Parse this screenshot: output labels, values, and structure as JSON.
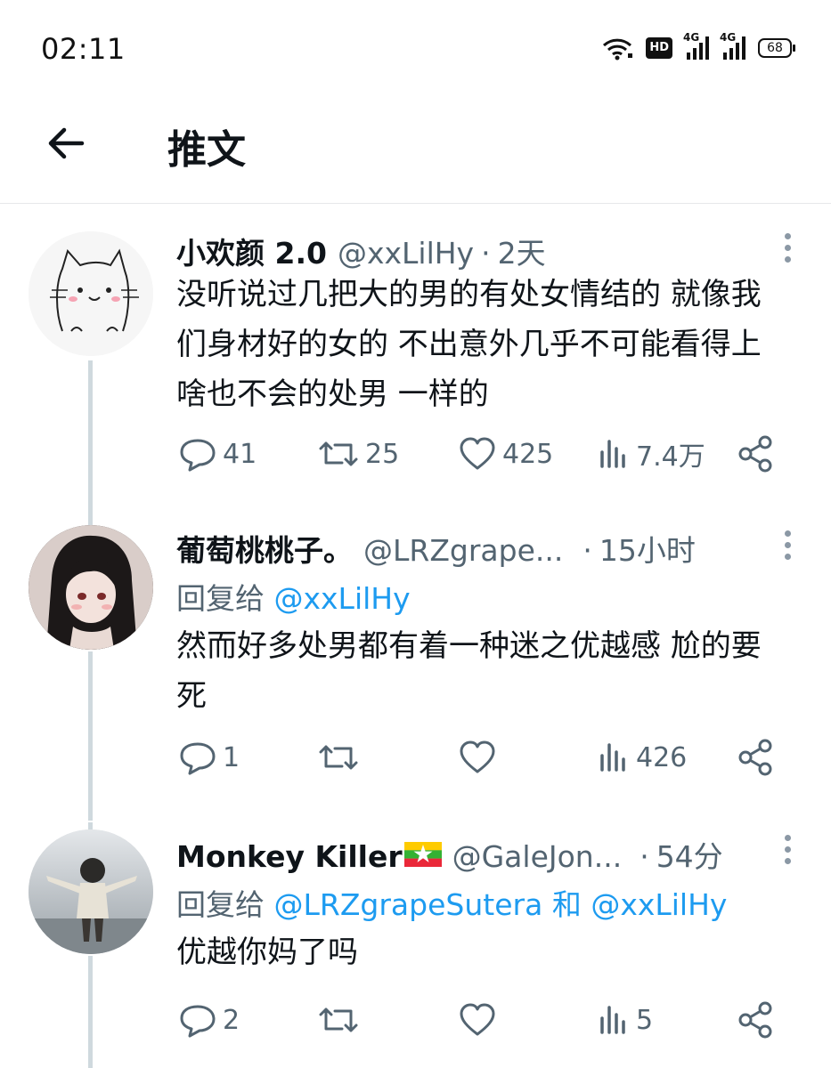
{
  "status_bar": {
    "time": "02:11",
    "hd_label": "HD",
    "network_1": "4G",
    "network_2": "4G",
    "battery": "68"
  },
  "header": {
    "title": "推文"
  },
  "tweets": [
    {
      "name": "小欢颜 2.0",
      "handle": "@xxLilHy",
      "time": "2天",
      "reply_prefix": "",
      "reply_to": "",
      "text": "没听说过几把大的男的有处女情结的 就像我们身材好的女的 不出意外几乎不可能看得上啥也不会的处男 一样的",
      "replies": "41",
      "retweets": "25",
      "likes": "425",
      "views": "7.4万"
    },
    {
      "name": "葡萄桃桃子。",
      "handle": "@LRZgrape...",
      "time": "15小时",
      "reply_prefix": "回复给",
      "reply_to": "@xxLilHy",
      "text": "然而好多处男都有着一种迷之优越感 尬的要死",
      "replies": "1",
      "retweets": "",
      "likes": "",
      "views": "426"
    },
    {
      "name": "Monkey Killer",
      "handle": "@GaleJon...",
      "time": "54分",
      "reply_prefix": "回复给",
      "reply_to": "@LRZgrapeSutera",
      "reply_and": "和",
      "reply_to_2": "@xxLilHy",
      "text": "优越你妈了吗",
      "replies": "2",
      "retweets": "",
      "likes": "",
      "views": "5"
    }
  ],
  "colors": {
    "accent": "#1d9bf0",
    "secondary_text": "#536471",
    "thread_line": "#cfd9de"
  }
}
